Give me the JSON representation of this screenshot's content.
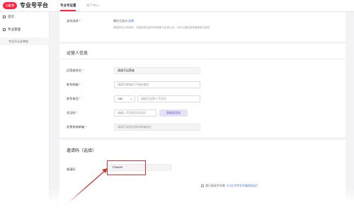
{
  "header": {
    "logo_text": "小红书",
    "platform_title": "专业号平台",
    "tabs": [
      {
        "label": "专业号设置"
      },
      {
        "label": "商户中心"
      }
    ]
  },
  "sidebar": {
    "items": [
      {
        "label": "首页"
      },
      {
        "label": "专业管理"
      }
    ],
    "sub_items": [
      {
        "label": "专业号认证审核"
      }
    ]
  },
  "identity_card": {
    "label": "身份选择",
    "selected": "播信号身份",
    "link": "选择",
    "hint": "请选择本主体身份，完善信息后提交审核即可生效认证，切可以重新选择重新提交身份"
  },
  "operator_card": {
    "title": "运营人信息",
    "fields": [
      {
        "label": "运营者姓名",
        "placeholder": "请填写运营者"
      },
      {
        "label": "联系邮箱",
        "placeholder": "请填写邮箱用于接收通知"
      },
      {
        "label": "联系电话",
        "prefix": "+86",
        "placeholder": "请填写运营人手机号"
      },
      {
        "label": "验证码",
        "placeholder": "请输入手机短信验证码",
        "button": "获取验证码"
      },
      {
        "label": "发票接收邮箱",
        "placeholder": "请填写接收发票的邮箱地址"
      }
    ]
  },
  "invite_card": {
    "title": "邀请码（选填）",
    "label": "邀请码",
    "value": "F06A90",
    "agreement_prefix": "我已阅读并同意",
    "agreement_link": "《小红书专业号服务协议》"
  },
  "colors": {
    "brand": "#ff2442",
    "highlight": "#c0392b",
    "link": "#3a6fd8"
  }
}
